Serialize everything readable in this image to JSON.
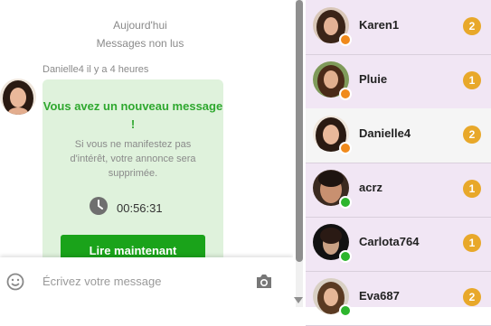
{
  "chat": {
    "date_label": "Aujourd'hui",
    "unread_label": "Messages non lus",
    "sender_line": "Danielle4 il y a 4 heures",
    "bubble": {
      "title": "Vous avez un nouveau message !",
      "body": "Si vous ne manifestez pas d'intérêt, votre annonce sera supprimée.",
      "timer": "00:56:31",
      "button_label": "Lire maintenant"
    },
    "input": {
      "placeholder": "Écrivez votre message",
      "emoji_icon": "emoji-icon",
      "camera_icon": "camera-icon"
    }
  },
  "conversations": [
    {
      "name": "Karen1",
      "count": "2",
      "status": "away"
    },
    {
      "name": "Pluie",
      "count": "1",
      "status": "away"
    },
    {
      "name": "Danielle4",
      "count": "2",
      "status": "away",
      "active": true
    },
    {
      "name": "acrz",
      "count": "1",
      "status": "online"
    },
    {
      "name": "Carlota764",
      "count": "1",
      "status": "online"
    },
    {
      "name": "Eva687",
      "count": "2",
      "status": "online"
    }
  ],
  "colors": {
    "away": "#f08a1c",
    "online": "#2db52d",
    "badge": "#e8a82a",
    "button": "#1aa31a",
    "bubble": "#dff2dc",
    "list_bg": "#f1e6f4"
  }
}
